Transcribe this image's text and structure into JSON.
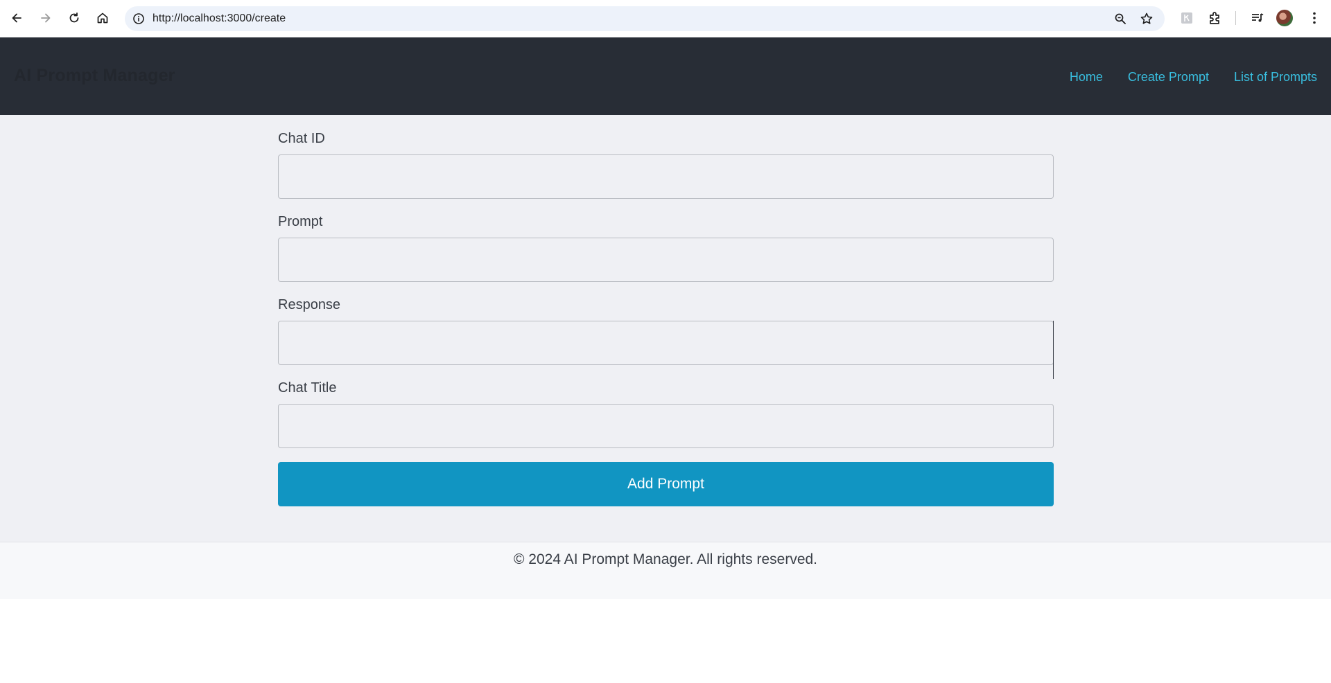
{
  "browser": {
    "url": "http://localhost:3000/create",
    "icons": {
      "back": "arrow-left-icon",
      "forward": "arrow-right-icon",
      "reload": "reload-icon",
      "home": "home-icon",
      "site_info": "info-icon",
      "zoom": "zoom-icon",
      "bookmark": "star-icon",
      "extension_1": "extension-icon",
      "extensions": "puzzle-icon",
      "media": "media-control-icon",
      "profile": "avatar-icon",
      "menu": "kebab-menu-icon"
    }
  },
  "navbar": {
    "brand": "AI Prompt Manager",
    "links": [
      "Home",
      "Create Prompt",
      "List of Prompts"
    ]
  },
  "form": {
    "fields": [
      {
        "label": "Chat ID",
        "value": ""
      },
      {
        "label": "Prompt",
        "value": ""
      },
      {
        "label": "Response",
        "value": ""
      },
      {
        "label": "Chat Title",
        "value": ""
      }
    ],
    "submit_label": "Add Prompt"
  },
  "footer": {
    "text": "© 2024 AI Prompt Manager. All rights reserved."
  },
  "colors": {
    "navbar_bg": "#282d36",
    "nav_link": "#39bfe0",
    "page_bg": "#eff0f4",
    "button_bg": "#1195c2",
    "footer_bg": "#f7f8fa"
  }
}
